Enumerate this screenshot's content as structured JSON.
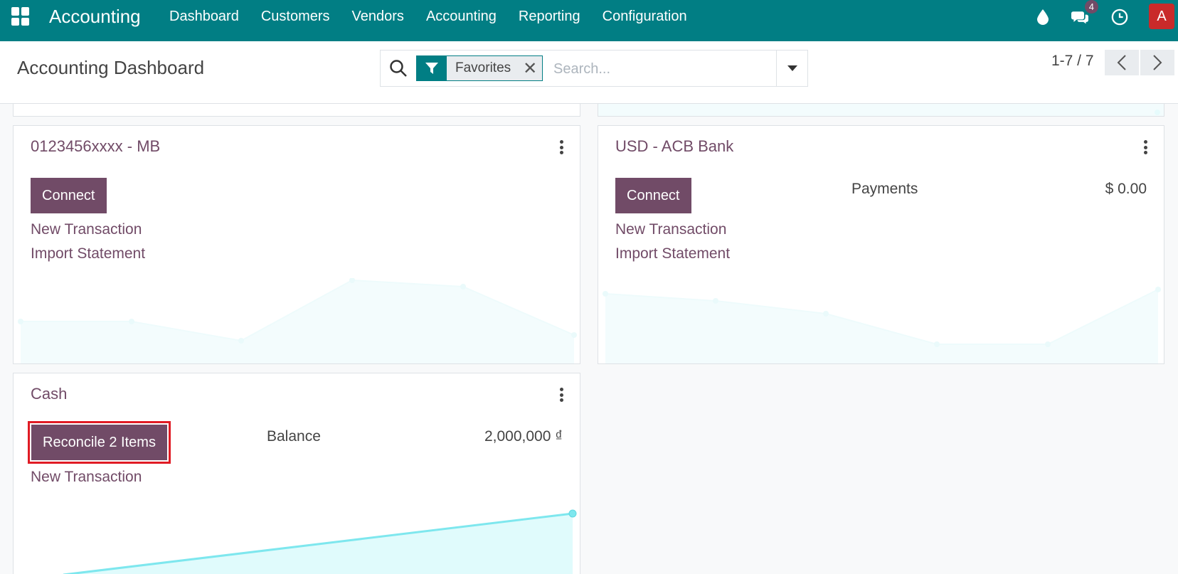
{
  "topbar": {
    "brand": "Accounting",
    "menu": [
      "Dashboard",
      "Customers",
      "Vendors",
      "Accounting",
      "Reporting",
      "Configuration"
    ],
    "messages_badge": "4",
    "avatar_letter": "A"
  },
  "control_panel": {
    "title": "Accounting Dashboard",
    "facet_label": "Favorites",
    "search_placeholder": "Search...",
    "pager": "1-7 / 7"
  },
  "cards": [
    {
      "title": "0123456xxxx - MB",
      "button": "Connect",
      "links": [
        "New Transaction",
        "Import Statement"
      ]
    },
    {
      "title": "USD - ACB Bank",
      "button": "Connect",
      "links": [
        "New Transaction",
        "Import Statement"
      ],
      "stat_label": "Payments",
      "stat_value": "$ 0.00"
    },
    {
      "title": "Cash",
      "button": "Reconcile 2 Items",
      "links": [
        "New Transaction"
      ],
      "stat_label": "Balance",
      "stat_value": "2,000,000 ₫"
    }
  ],
  "colors": {
    "topbar": "#017e84",
    "primary": "#714b67",
    "graph_line": "#7ee7ee",
    "highlight": "#e01b24"
  }
}
